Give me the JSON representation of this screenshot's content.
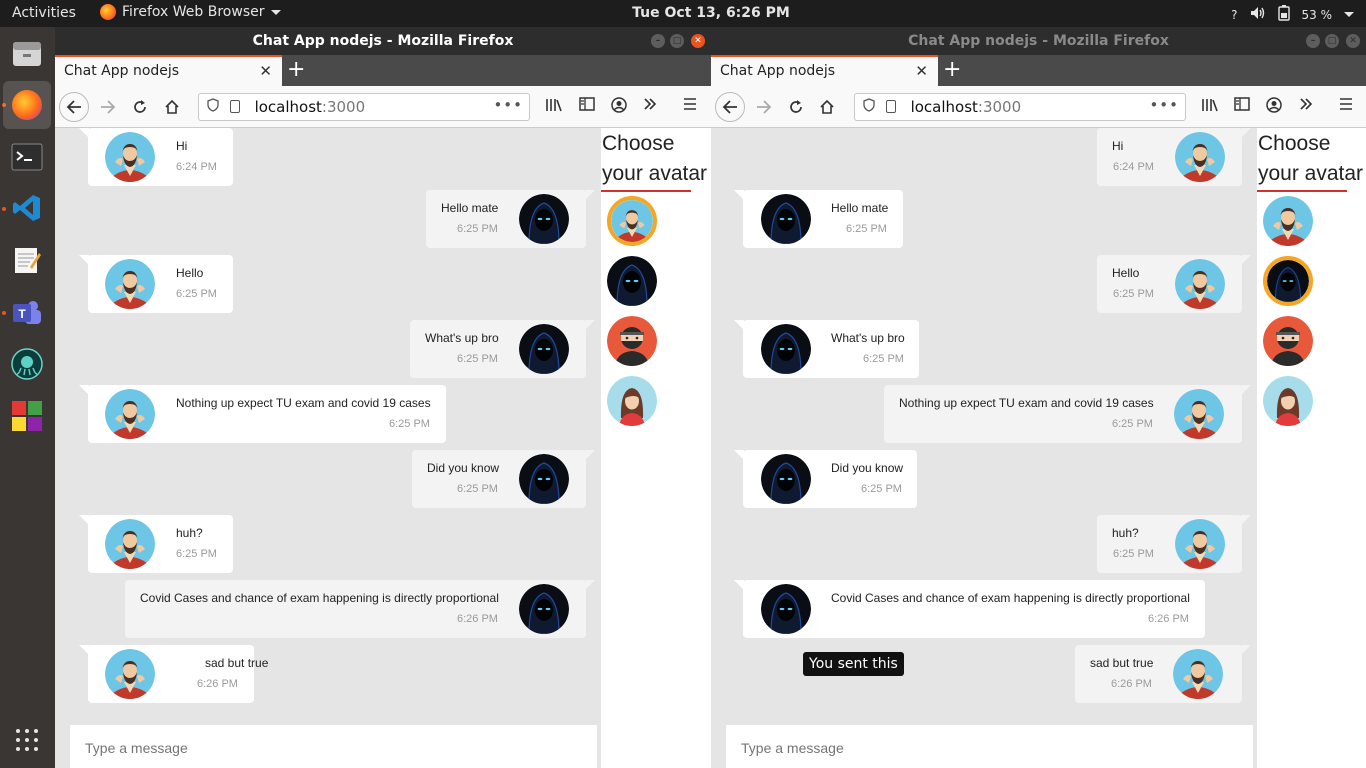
{
  "topbar": {
    "activities": "Activities",
    "app_name": "Firefox Web Browser",
    "clock": "Tue Oct 13,  6:26 PM",
    "help": "?",
    "battery": "53 %"
  },
  "dock": {
    "items": [
      "file-manager",
      "firefox",
      "terminal",
      "vscode",
      "text-editor",
      "teams",
      "gitkraken",
      "app-colors",
      "show-apps"
    ]
  },
  "window_left": {
    "title": "Chat App nodejs - Mozilla Firefox",
    "tab_title": "Chat App nodejs",
    "url_host": "localhost",
    "url_port": ":3000"
  },
  "window_right": {
    "title": "Chat App nodejs - Mozilla Firefox",
    "tab_title": "Chat App nodejs",
    "url_host": "localhost",
    "url_port": ":3000",
    "tooltip": "You sent this"
  },
  "sidebar": {
    "heading_line1": "Choose",
    "heading_line2": "your avatar"
  },
  "input_placeholder": "Type a message",
  "messages": [
    {
      "text": "Hi",
      "time": "6:24 PM",
      "sender": "man"
    },
    {
      "text": "Hello mate",
      "time": "6:25 PM",
      "sender": "hood"
    },
    {
      "text": "Hello",
      "time": "6:25 PM",
      "sender": "man"
    },
    {
      "text": "What's up bro",
      "time": "6:25 PM",
      "sender": "hood"
    },
    {
      "text": "Nothing up expect TU exam and covid 19 cases",
      "time": "6:25 PM",
      "sender": "man"
    },
    {
      "text": "Did you know",
      "time": "6:25 PM",
      "sender": "hood"
    },
    {
      "text": "huh?",
      "time": "6:25 PM",
      "sender": "man"
    },
    {
      "text": "Covid Cases and chance of exam happening is directly proportional",
      "time": "6:26 PM",
      "sender": "hood"
    },
    {
      "text": "sad but true",
      "time": "6:26 PM",
      "sender": "man"
    }
  ],
  "avatar_options": [
    "bearded-man",
    "hooded-figure",
    "ninja",
    "woman"
  ],
  "colors": {
    "accent": "#e95420",
    "underline": "#d32f2f",
    "chat_bg": "#e5e5e5",
    "man_avatar_bg": "#6ec6e6",
    "ninja_bg": "#e8593b",
    "selected_ring": "#f5a623"
  }
}
